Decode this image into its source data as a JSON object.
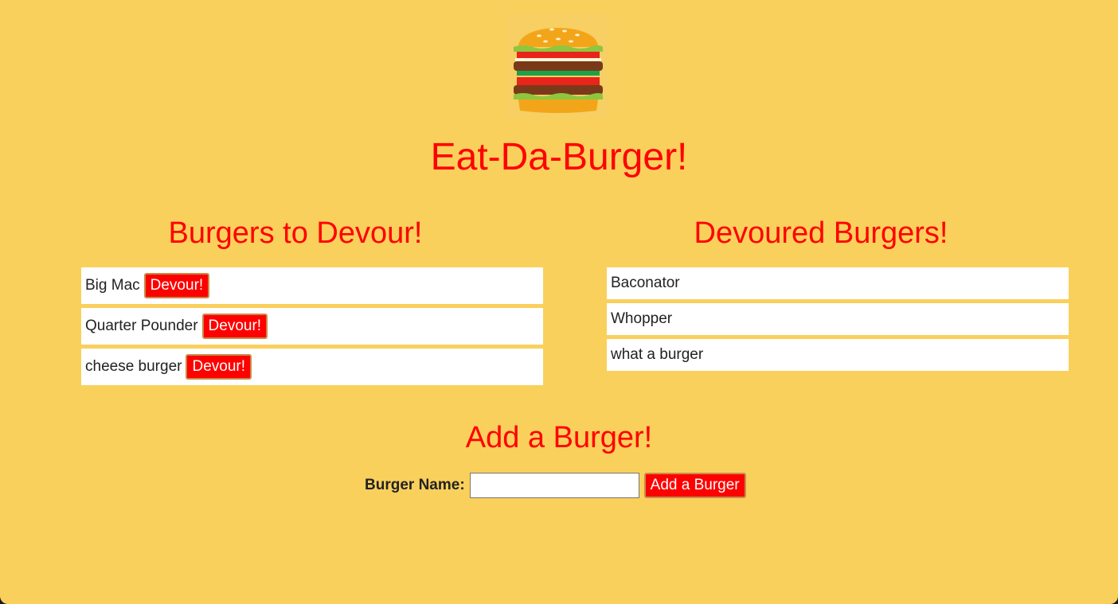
{
  "header": {
    "title": "Eat-Da-Burger!"
  },
  "to_devour": {
    "title": "Burgers to Devour!",
    "button_label": "Devour!",
    "items": [
      "Big Mac",
      "Quarter Pounder",
      "cheese burger"
    ]
  },
  "devoured": {
    "title": "Devoured Burgers!",
    "items": [
      "Baconator",
      "Whopper",
      "what a burger"
    ]
  },
  "add_form": {
    "title": "Add a Burger!",
    "label": "Burger Name:",
    "input_value": "",
    "submit_label": "Add a Burger"
  },
  "colors": {
    "background": "#fad05c",
    "accent": "#ff0000",
    "card": "#ffffff"
  },
  "icons": {
    "logo": "burger-logo-icon"
  }
}
